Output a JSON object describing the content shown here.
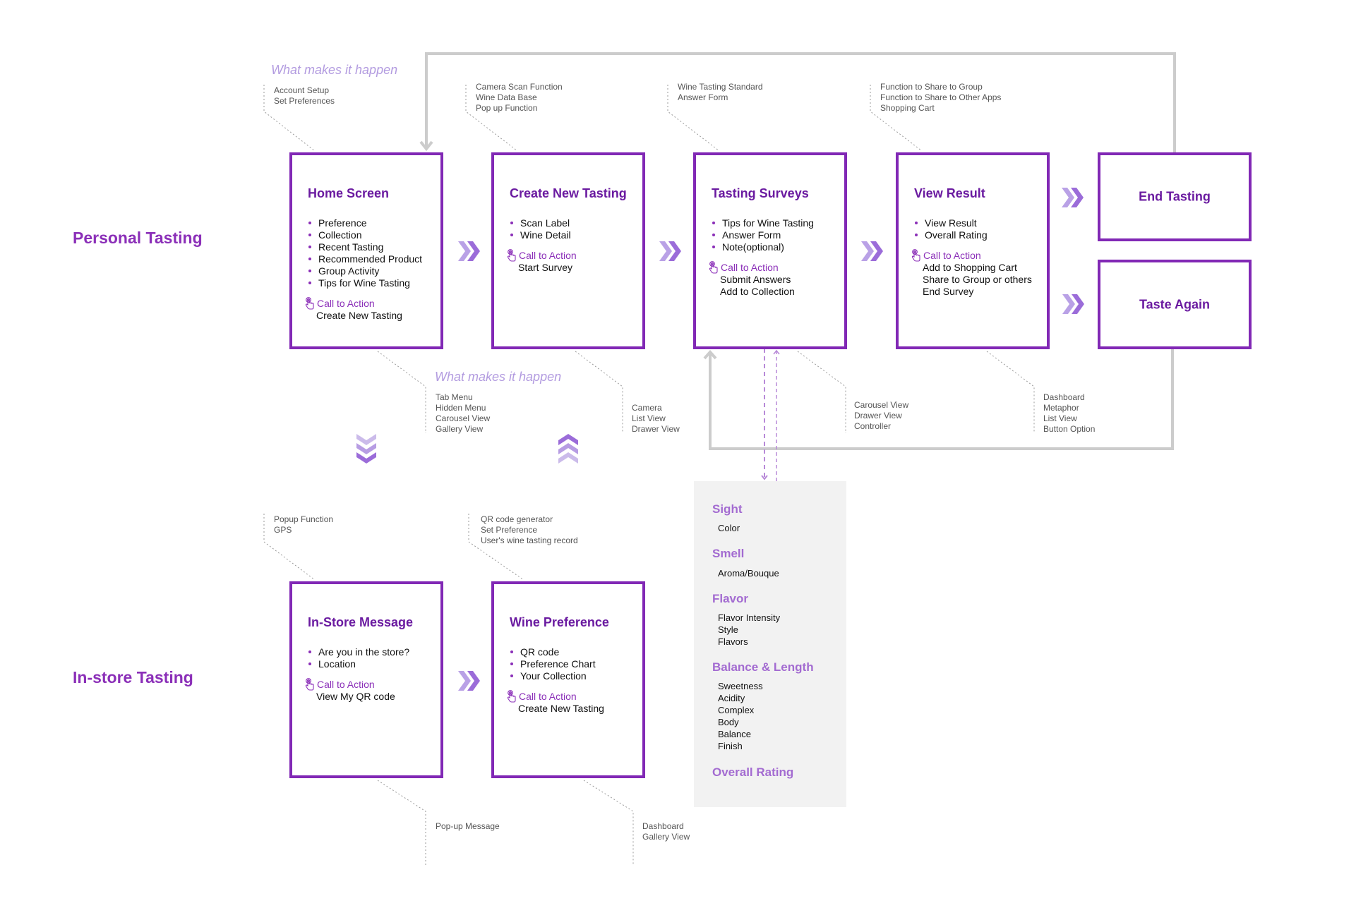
{
  "sections": {
    "personal": "Personal Tasting",
    "instore": "In-store Tasting"
  },
  "what_makes_it_happen": "What makes it happen",
  "colors": {
    "box_border": "#8128b5",
    "title": "#6a1aa0",
    "accent": "#8b2fb8",
    "light_accent": "#b39ce0",
    "connector": "#cccccc",
    "panel_bg": "#f2f2f2"
  },
  "cta_label": "Call to Action",
  "personal_flow": [
    {
      "title": "Home Screen",
      "bullets": [
        "Preference",
        "Collection",
        "Recent Tasting",
        "Recommended Product",
        "Group Activity",
        "Tips for Wine Tasting"
      ],
      "cta": [
        "Create New Tasting"
      ],
      "top_note": [
        "Account Setup",
        "Set Preferences"
      ],
      "bottom_note": [
        "Tab Menu",
        "Hidden Menu",
        "Carousel View",
        "Gallery View"
      ]
    },
    {
      "title": "Create New Tasting",
      "bullets": [
        "Scan Label",
        "Wine Detail"
      ],
      "cta": [
        "Start Survey"
      ],
      "top_note": [
        "Camera Scan Function",
        "Wine Data Base",
        "Pop up Function"
      ],
      "bottom_note": [
        "Camera",
        "List View",
        "Drawer View"
      ]
    },
    {
      "title": "Tasting Surveys",
      "bullets": [
        "Tips for Wine Tasting",
        "Answer Form",
        "Note(optional)"
      ],
      "cta": [
        "Submit Answers",
        "Add to Collection"
      ],
      "top_note": [
        "Wine Tasting Standard",
        "Answer Form"
      ],
      "bottom_note": [
        "Carousel View",
        "Drawer View",
        "Controller"
      ]
    },
    {
      "title": "View Result",
      "bullets": [
        "View Result",
        "Overall Rating"
      ],
      "cta": [
        "Add to Shopping Cart",
        "Share to Group or others",
        "End Survey"
      ],
      "top_note": [
        "Function to Share to Group",
        "Function to Share to Other Apps",
        "Shopping Cart"
      ],
      "bottom_note": [
        "Dashboard",
        "Metaphor",
        "List View",
        "Button Option"
      ]
    }
  ],
  "end_states": [
    "End Tasting",
    "Taste Again"
  ],
  "instore_flow": [
    {
      "title": "In-Store Message",
      "bullets": [
        "Are you in the store?",
        "Location"
      ],
      "cta": [
        "View My QR code"
      ],
      "top_note": [
        "Popup Function",
        "GPS"
      ],
      "bottom_note": [
        "Pop-up Message"
      ]
    },
    {
      "title": "Wine Preference",
      "bullets": [
        "QR code",
        "Preference Chart",
        "Your Collection"
      ],
      "cta": [
        "Create New Tasting"
      ],
      "top_note": [
        "QR code generator",
        "Set Preference",
        "User's wine tasting record"
      ],
      "bottom_note": [
        "Dashboard",
        "Gallery View"
      ]
    }
  ],
  "survey_panel": [
    {
      "heading": "Sight",
      "items": [
        "Color"
      ]
    },
    {
      "heading": "Smell",
      "items": [
        "Aroma/Bouque"
      ]
    },
    {
      "heading": "Flavor",
      "items": [
        "Flavor Intensity",
        "Style",
        "Flavors"
      ]
    },
    {
      "heading": "Balance & Length",
      "items": [
        "Sweetness",
        "Acidity",
        "Complex",
        "Body",
        "Balance",
        "Finish"
      ]
    },
    {
      "heading": "Overall Rating",
      "items": []
    }
  ],
  "icons": {
    "cta": "tap-hand-icon",
    "flow_arrow": "double-chevron-right-icon",
    "down": "triple-chevron-down-icon",
    "up": "triple-chevron-up-icon"
  }
}
